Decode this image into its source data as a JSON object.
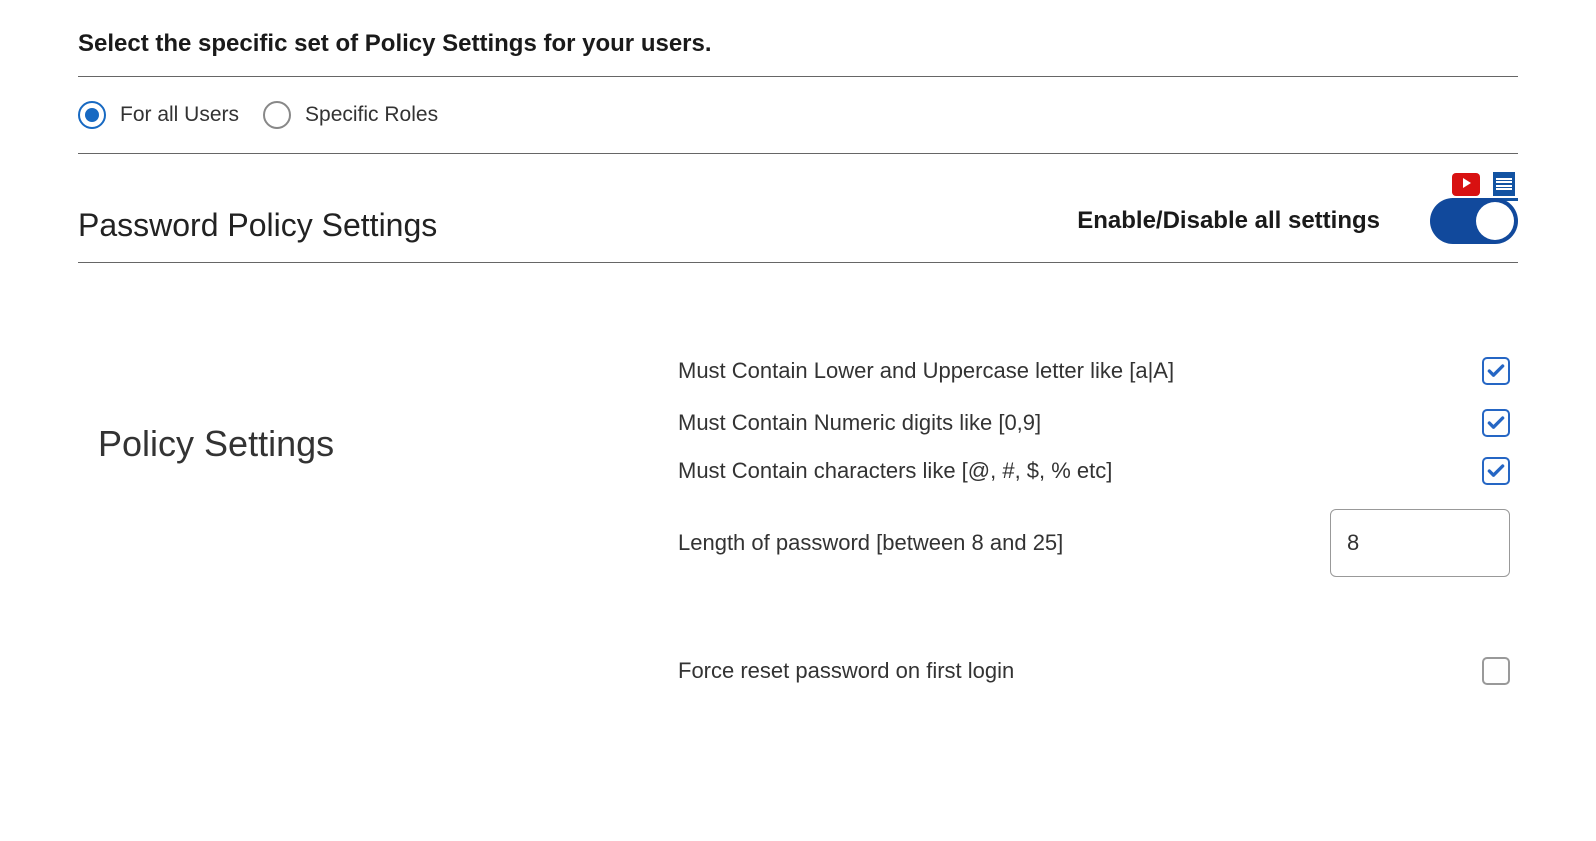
{
  "header": {
    "instruction": "Select the specific set of Policy Settings for your users."
  },
  "scope": {
    "for_all_users_label": "For all Users",
    "specific_roles_label": "Specific Roles",
    "selected": "for_all_users"
  },
  "section": {
    "title": "Password Policy Settings",
    "toggle_label": "Enable/Disable all settings",
    "toggle_state": true
  },
  "icons": {
    "video": "video-help-icon",
    "doc": "document-help-icon"
  },
  "policy": {
    "subtitle": "Policy Settings",
    "rows": {
      "case_label": "Must Contain Lower and Uppercase letter like [a|A]",
      "case_checked": true,
      "numeric_label": "Must Contain Numeric digits like [0,9]",
      "numeric_checked": true,
      "special_label": "Must Contain characters like [@, #, $, % etc]",
      "special_checked": true,
      "length_label": "Length of password [between 8 and 25]",
      "length_value": "8",
      "force_reset_label": "Force reset password on first login",
      "force_reset_checked": false
    }
  }
}
